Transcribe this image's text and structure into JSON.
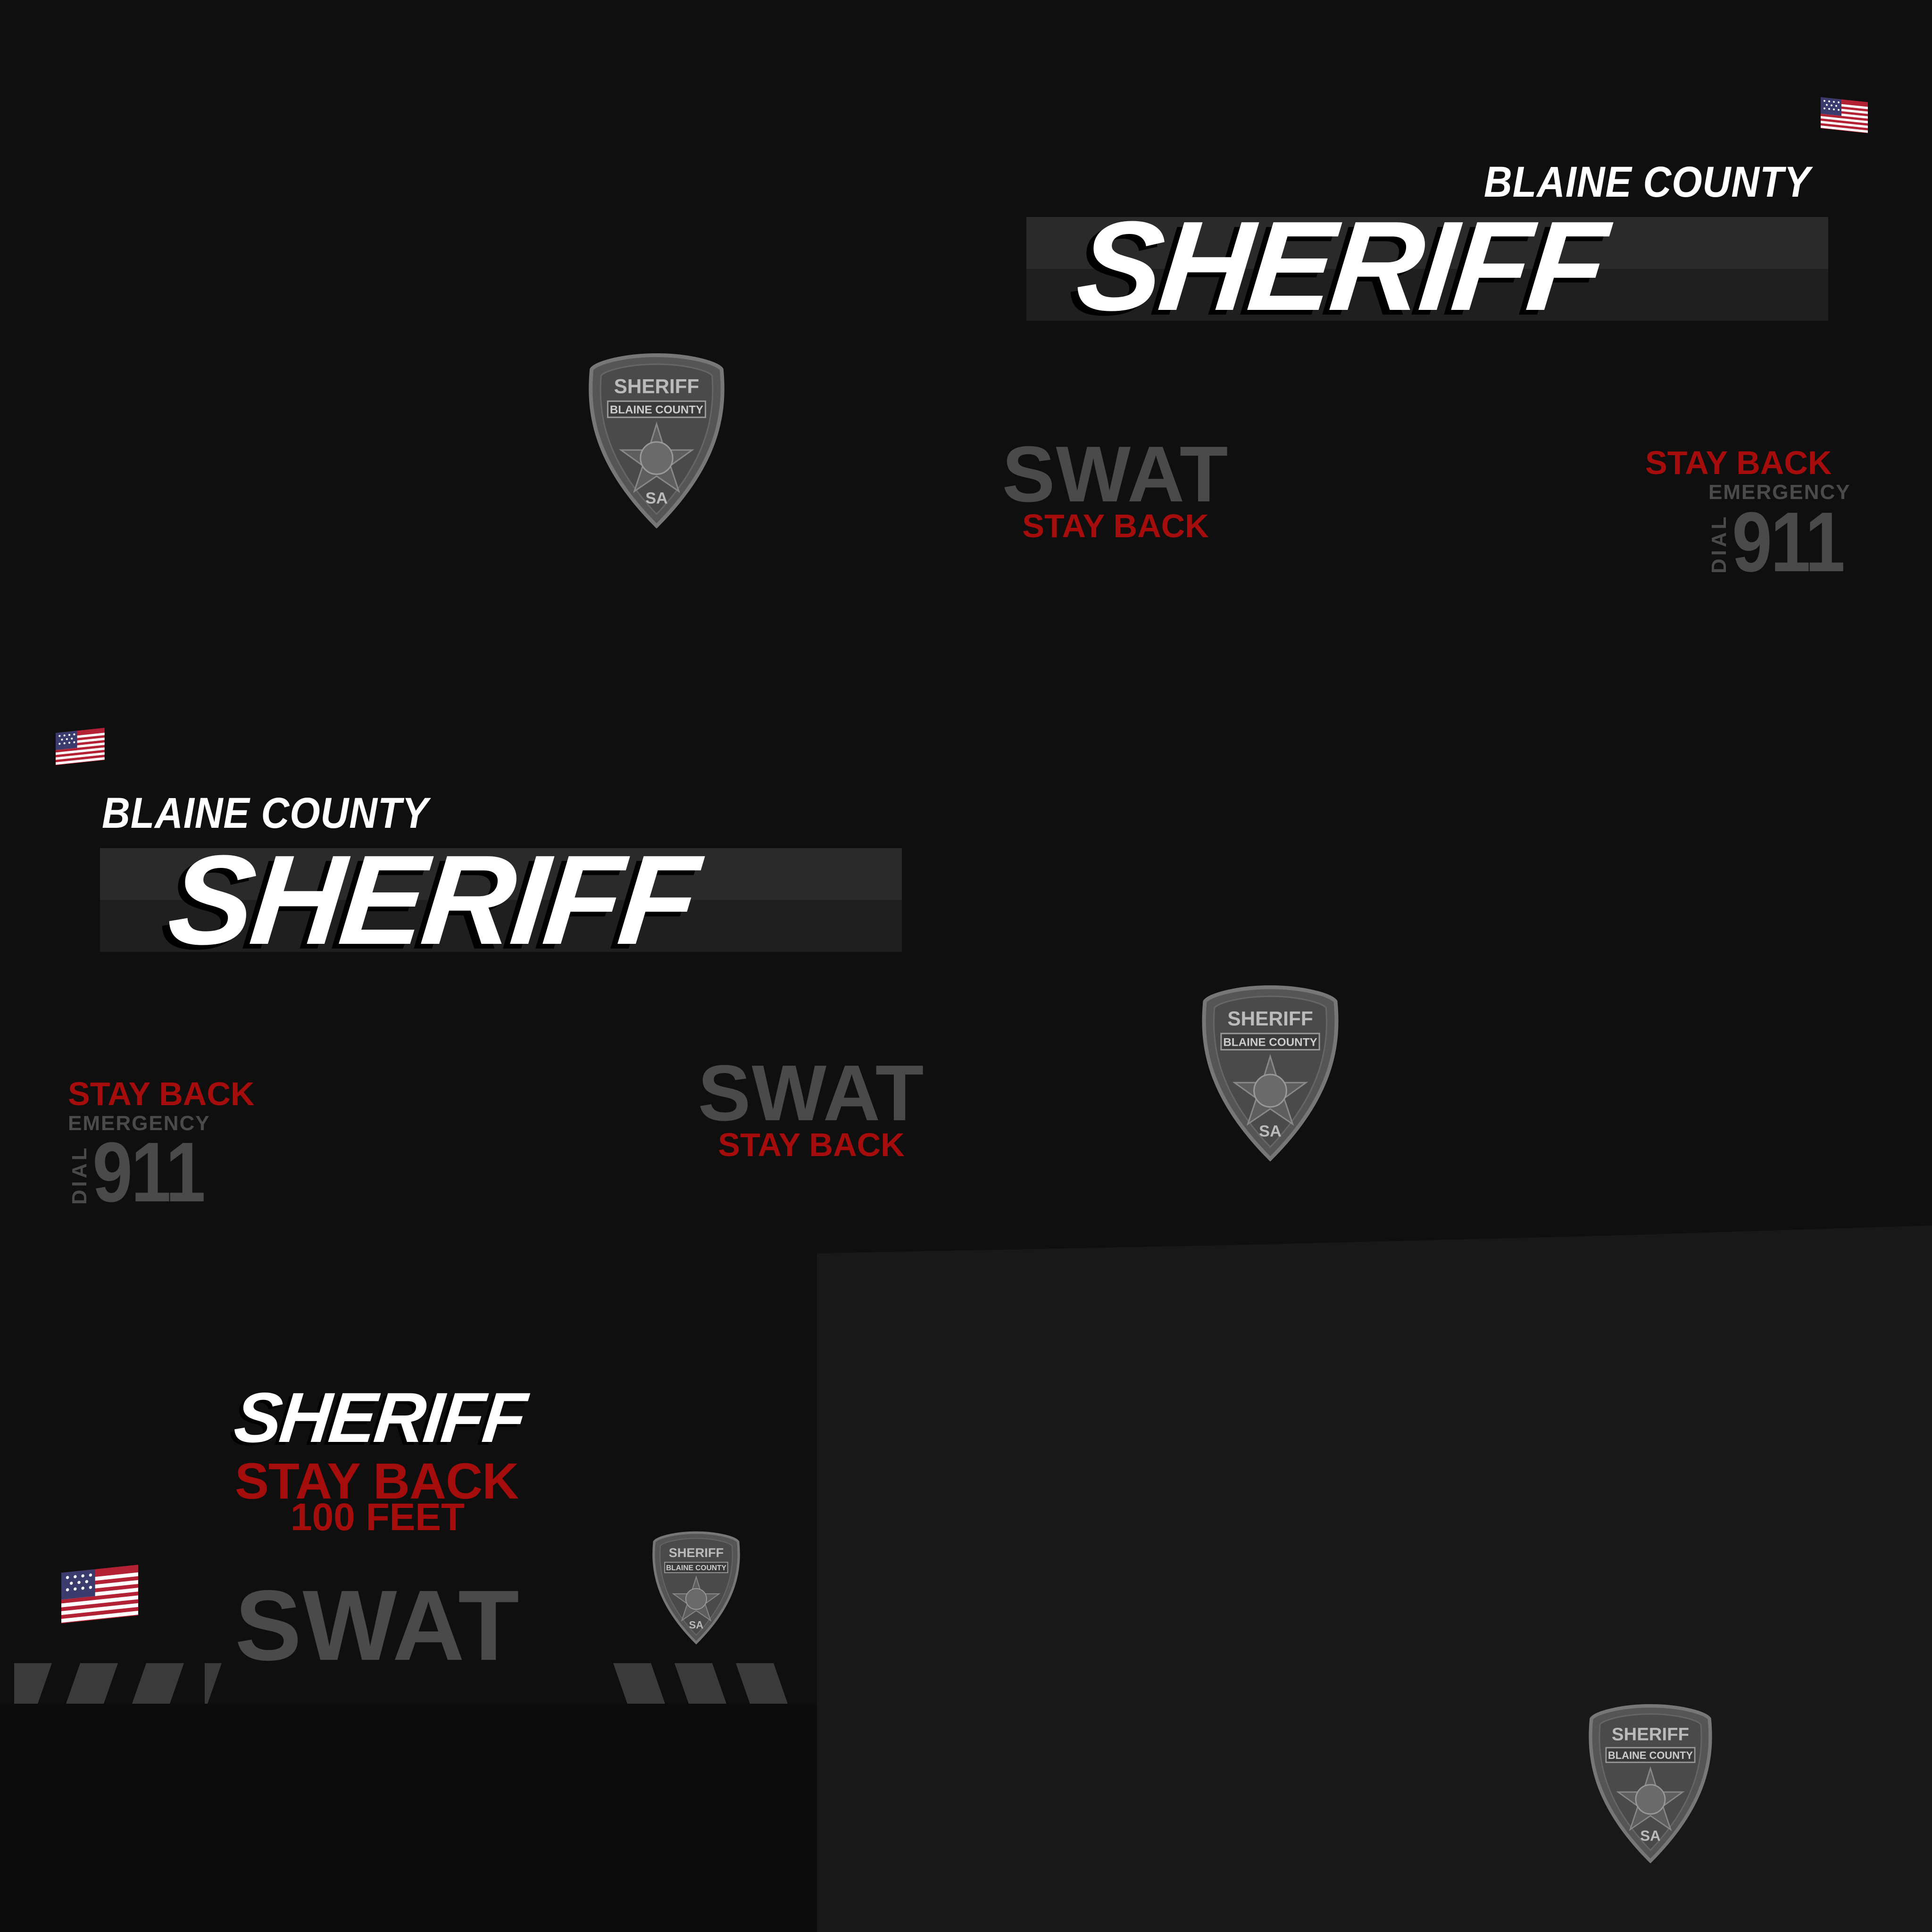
{
  "colors": {
    "background": "#0f0f0f",
    "panel": "#181818",
    "accent_red": "#a50c0c",
    "muted_gray": "#4a4a4a",
    "white": "#ffffff"
  },
  "banner_top": {
    "county": "BLAINE COUNTY",
    "title": "SHERIFF"
  },
  "banner_mid": {
    "county": "BLAINE COUNTY",
    "title": "SHERIFF"
  },
  "swat_top": {
    "word": "SWAT",
    "sub": "STAY BACK"
  },
  "swat_mid": {
    "word": "SWAT",
    "sub": "STAY BACK"
  },
  "emergency_top": {
    "stay_back": "STAY BACK",
    "emergency": "EMERGENCY",
    "dial": "DIAL",
    "number": "911"
  },
  "emergency_mid": {
    "stay_back": "STAY BACK",
    "emergency": "EMERGENCY",
    "dial": "DIAL",
    "number": "911"
  },
  "rear_panel": {
    "title": "SHERIFF",
    "stay_back": "STAY BACK",
    "distance": "100 FEET",
    "swat": "SWAT"
  },
  "badge": {
    "top": "SHERIFF",
    "county": "BLAINE COUNTY",
    "bottom": "SA"
  },
  "icons": [
    "us-flag-icon",
    "sheriff-badge-icon"
  ]
}
